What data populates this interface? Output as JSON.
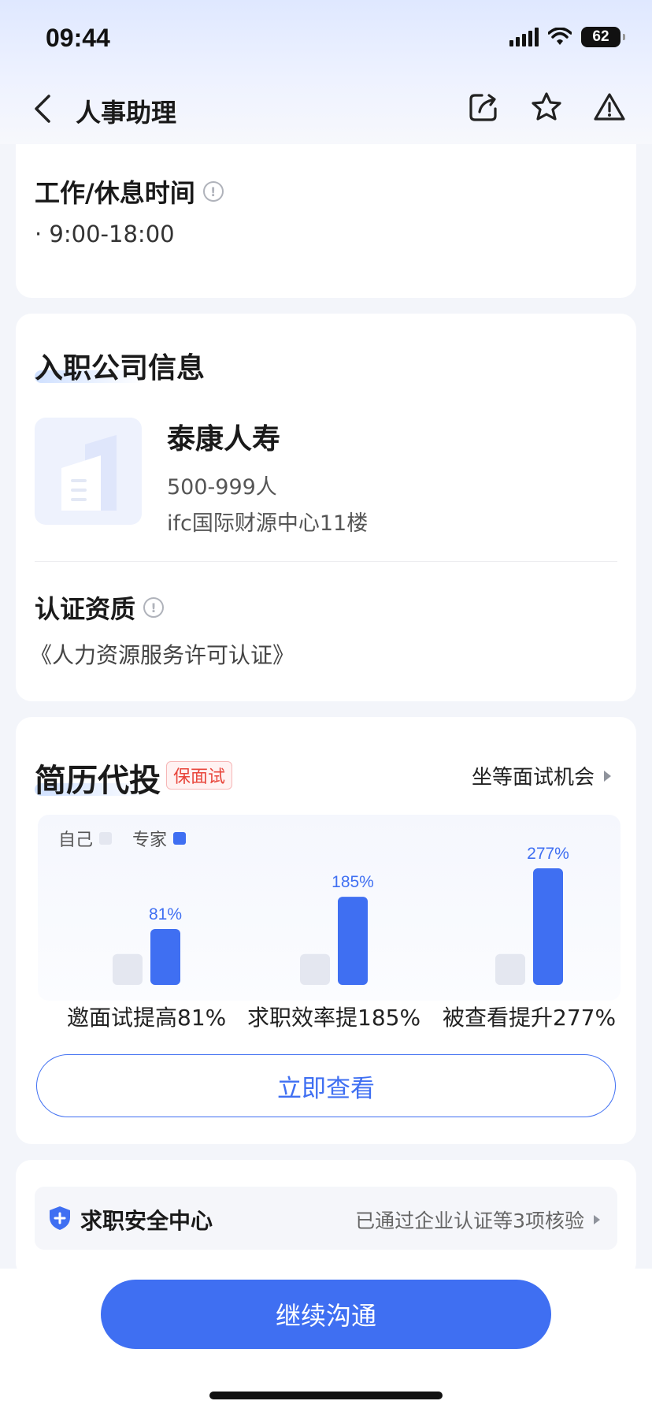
{
  "status_bar": {
    "time": "09:44",
    "battery": "62"
  },
  "nav": {
    "title": "人事助理"
  },
  "work_time": {
    "heading": "工作/休息时间",
    "value": "· 9:00-18:00"
  },
  "company_section": {
    "heading": "入职公司信息",
    "name": "泰康人寿",
    "size": "500-999人",
    "address": "ifc国际财源中心11楼",
    "cert_heading": "认证资质",
    "cert_value": "《人力资源服务许可认证》"
  },
  "resume_section": {
    "heading": "简历代投",
    "tag": "保面试",
    "link": "坐等面试机会",
    "legend_self": "自己",
    "legend_expert": "专家",
    "button": "立即查看"
  },
  "chart_data": {
    "type": "bar",
    "categories": [
      "邀面试提高81%",
      "求职效率提185%",
      "被查看提升277%"
    ],
    "series": [
      {
        "name": "自己",
        "values": [
          100,
          100,
          100
        ],
        "color": "#e4e7f0"
      },
      {
        "name": "专家",
        "values": [
          181,
          285,
          377
        ],
        "color": "#3f6ff2"
      }
    ],
    "data_labels": [
      "81%",
      "185%",
      "277%"
    ],
    "title": "",
    "xlabel": "",
    "ylabel": "",
    "legend": "top-left"
  },
  "safety": {
    "title": "求职安全中心",
    "status": "已通过企业认证等3项核验"
  },
  "bottom": {
    "button": "继续沟通"
  }
}
